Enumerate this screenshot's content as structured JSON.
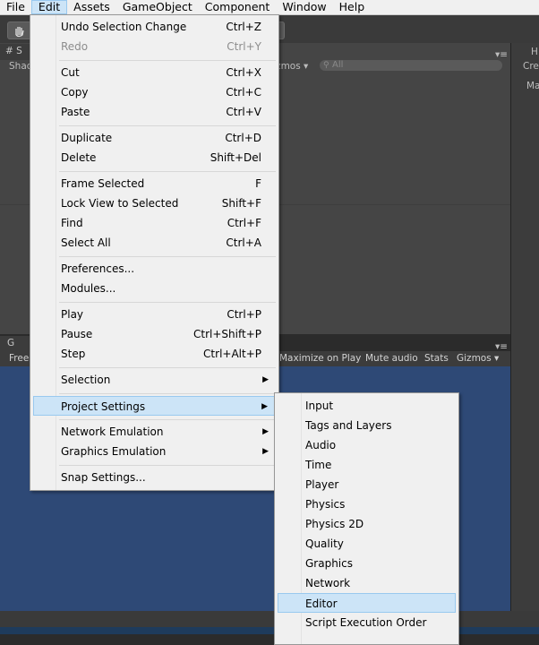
{
  "menubar": [
    "File",
    "Edit",
    "Assets",
    "GameObject",
    "Component",
    "Window",
    "Help"
  ],
  "scene": {
    "tab_prefix": "# S",
    "shading_prefix": "Shad",
    "gizmos": "Gizmos ▾",
    "search_placeholder": "All",
    "inspector_prefix": "H",
    "create_prefix": "Cre",
    "main_prefix": "Ma"
  },
  "game": {
    "tab_prefix": "G",
    "free_prefix": "Free",
    "buttons": [
      "Maximize on Play",
      "Mute audio",
      "Stats",
      "Gizmos ▾"
    ]
  },
  "edit_menu": {
    "items": [
      {
        "label": "Undo Selection Change",
        "shortcut": "Ctrl+Z"
      },
      {
        "label": "Redo",
        "shortcut": "Ctrl+Y",
        "disabled": true
      },
      {
        "label": "Cut",
        "shortcut": "Ctrl+X"
      },
      {
        "label": "Copy",
        "shortcut": "Ctrl+C"
      },
      {
        "label": "Paste",
        "shortcut": "Ctrl+V"
      },
      {
        "label": "Duplicate",
        "shortcut": "Ctrl+D"
      },
      {
        "label": "Delete",
        "shortcut": "Shift+Del"
      },
      {
        "label": "Frame Selected",
        "shortcut": "F"
      },
      {
        "label": "Lock View to Selected",
        "shortcut": "Shift+F"
      },
      {
        "label": "Find",
        "shortcut": "Ctrl+F"
      },
      {
        "label": "Select All",
        "shortcut": "Ctrl+A"
      },
      {
        "label": "Preferences...",
        "shortcut": ""
      },
      {
        "label": "Modules...",
        "shortcut": ""
      },
      {
        "label": "Play",
        "shortcut": "Ctrl+P"
      },
      {
        "label": "Pause",
        "shortcut": "Ctrl+Shift+P"
      },
      {
        "label": "Step",
        "shortcut": "Ctrl+Alt+P"
      },
      {
        "label": "Selection",
        "submenu": true
      },
      {
        "label": "Project Settings",
        "submenu": true,
        "highlighted": true
      },
      {
        "label": "Network Emulation",
        "submenu": true
      },
      {
        "label": "Graphics Emulation",
        "submenu": true
      },
      {
        "label": "Snap Settings...",
        "shortcut": ""
      }
    ]
  },
  "project_settings_menu": {
    "items": [
      "Input",
      "Tags and Layers",
      "Audio",
      "Time",
      "Player",
      "Physics",
      "Physics 2D",
      "Quality",
      "Graphics",
      "Network",
      "Editor",
      "Script Execution Order"
    ],
    "highlighted": "Editor"
  }
}
